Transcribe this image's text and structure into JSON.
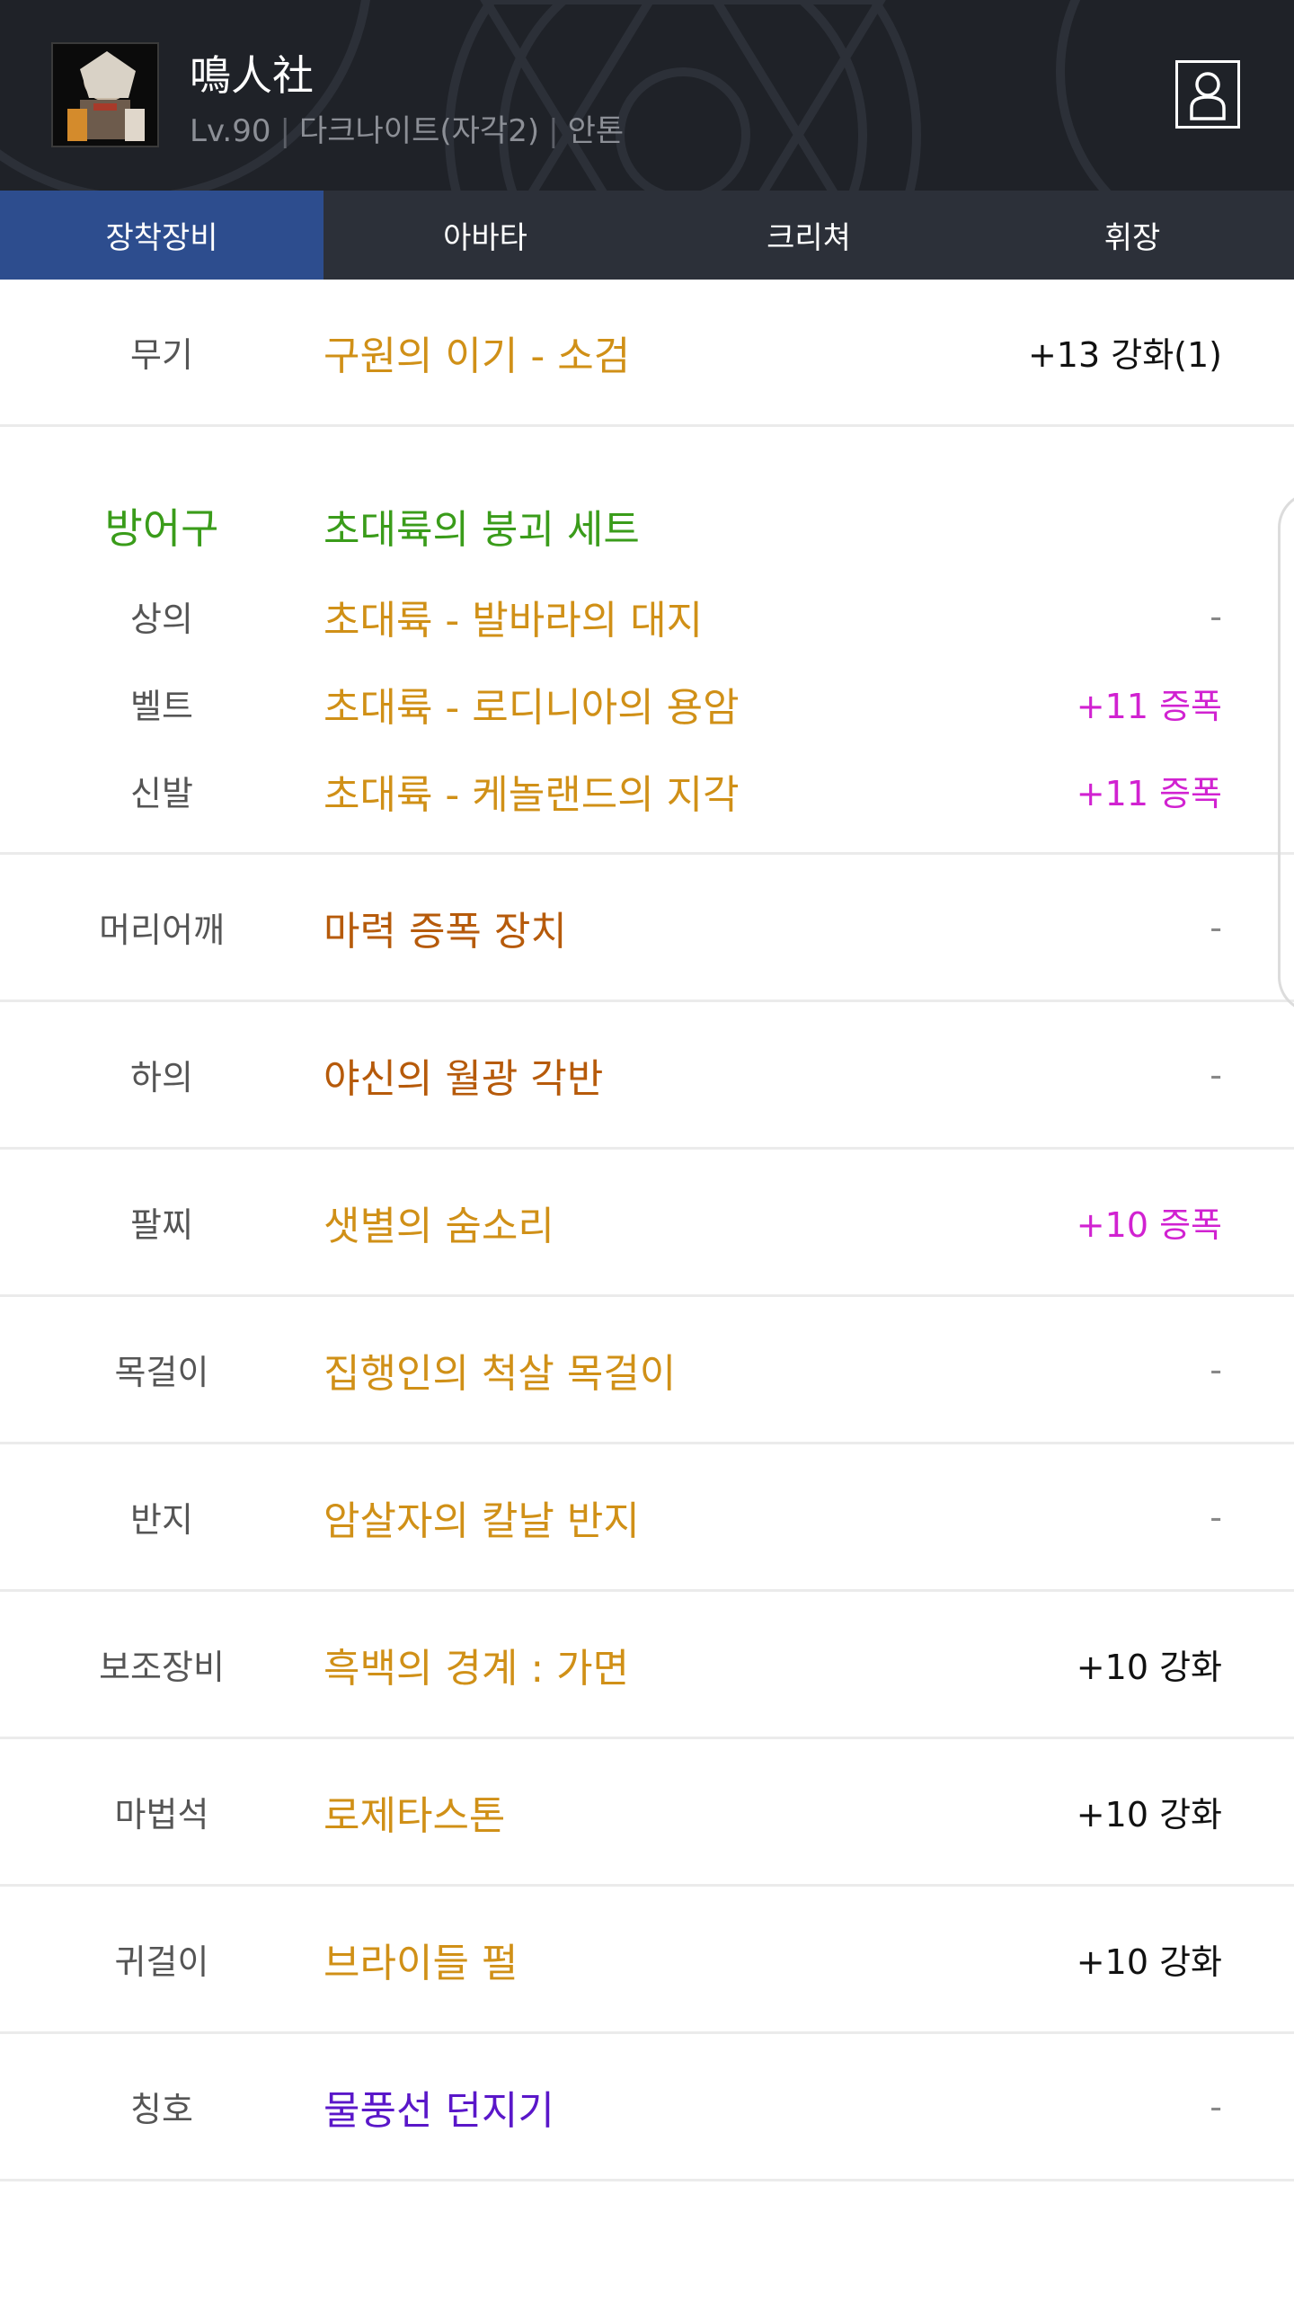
{
  "header": {
    "character_name": "鳴人社",
    "level": "Lv.90",
    "job": "다크나이트(자각2)",
    "server": "안톤",
    "separator": "|"
  },
  "tabs": [
    {
      "label": "장착장비",
      "active": true
    },
    {
      "label": "아바타",
      "active": false
    },
    {
      "label": "크리쳐",
      "active": false
    },
    {
      "label": "휘장",
      "active": false
    }
  ],
  "equipment": {
    "weapon": {
      "slot": "무기",
      "item": "구원의 이기 - 소검",
      "enhance": "+13 강화(1)",
      "item_color": "#d09017",
      "enhance_color": "#111111"
    },
    "armor_set": {
      "slot": "방어구",
      "set_name": "초대륙의 붕괴 세트",
      "color": "#3a9c1a",
      "pieces": [
        {
          "slot": "상의",
          "item": "초대륙 - 발바라의 대지",
          "enhance": "-",
          "item_color": "#d09017",
          "enhance_color": "#888888"
        },
        {
          "slot": "벨트",
          "item": "초대륙 - 로디니아의 용암",
          "enhance": "+11 증폭",
          "item_color": "#d09017",
          "enhance_color": "#d122d1"
        },
        {
          "slot": "신발",
          "item": "초대륙 - 케놀랜드의 지각",
          "enhance": "+11 증폭",
          "item_color": "#d09017",
          "enhance_color": "#d122d1"
        }
      ]
    },
    "rows": [
      {
        "slot": "머리어깨",
        "item": "마력 증폭 장치",
        "enhance": "-",
        "item_color": "#b65a0a",
        "enhance_color": "#888888"
      },
      {
        "slot": "하의",
        "item": "야신의 월광 각반",
        "enhance": "-",
        "item_color": "#b65a0a",
        "enhance_color": "#888888"
      },
      {
        "slot": "팔찌",
        "item": "샛별의 숨소리",
        "enhance": "+10 증폭",
        "item_color": "#d09017",
        "enhance_color": "#d122d1"
      },
      {
        "slot": "목걸이",
        "item": "집행인의 척살 목걸이",
        "enhance": "-",
        "item_color": "#d09017",
        "enhance_color": "#888888"
      },
      {
        "slot": "반지",
        "item": "암살자의 칼날 반지",
        "enhance": "-",
        "item_color": "#d09017",
        "enhance_color": "#888888"
      },
      {
        "slot": "보조장비",
        "item": "흑백의 경계 : 가면",
        "enhance": "+10 강화",
        "item_color": "#d09017",
        "enhance_color": "#111111"
      },
      {
        "slot": "마법석",
        "item": "로제타스톤",
        "enhance": "+10 강화",
        "item_color": "#d09017",
        "enhance_color": "#111111"
      },
      {
        "slot": "귀걸이",
        "item": "브라이들 펄",
        "enhance": "+10 강화",
        "item_color": "#d09017",
        "enhance_color": "#111111"
      },
      {
        "slot": "칭호",
        "item": "물풍선 던지기",
        "enhance": "-",
        "item_color": "#5a17c9",
        "enhance_color": "#888888"
      }
    ]
  },
  "icons": {
    "avatar": "character-portrait",
    "profile": "profile-icon"
  }
}
